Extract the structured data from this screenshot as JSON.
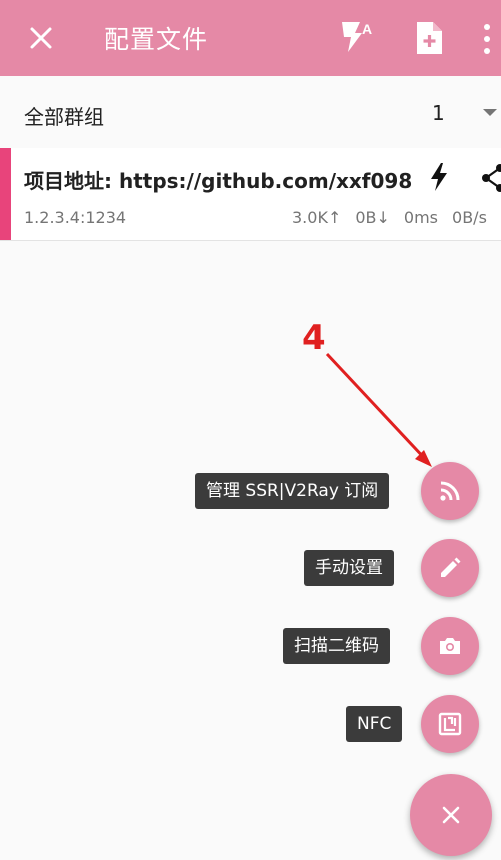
{
  "appbar": {
    "title": "配置文件",
    "icons": [
      "close-icon",
      "bolt-auto-icon",
      "new-file-icon",
      "more-vert-icon"
    ],
    "color": "#e589a6"
  },
  "group_row": {
    "label": "全部群组",
    "count": "1"
  },
  "server": {
    "name": "项目地址: https://github.com/xxf098",
    "address": "1.2.3.4:1234",
    "upload": "3.0K↑",
    "download": "0B↓",
    "latency": "0ms",
    "speed": "0B/s",
    "accent_color": "#e8447b"
  },
  "annotation": {
    "number": "4",
    "color": "#e02020"
  },
  "fab_menu": {
    "items": [
      {
        "label": "管理 SSR|V2Ray 订阅",
        "icon": "rss-icon"
      },
      {
        "label": "手动设置",
        "icon": "pencil-icon"
      },
      {
        "label": "扫描二维码",
        "icon": "camera-icon"
      },
      {
        "label": "NFC",
        "icon": "nfc-icon"
      }
    ],
    "close_icon": "close-icon"
  }
}
